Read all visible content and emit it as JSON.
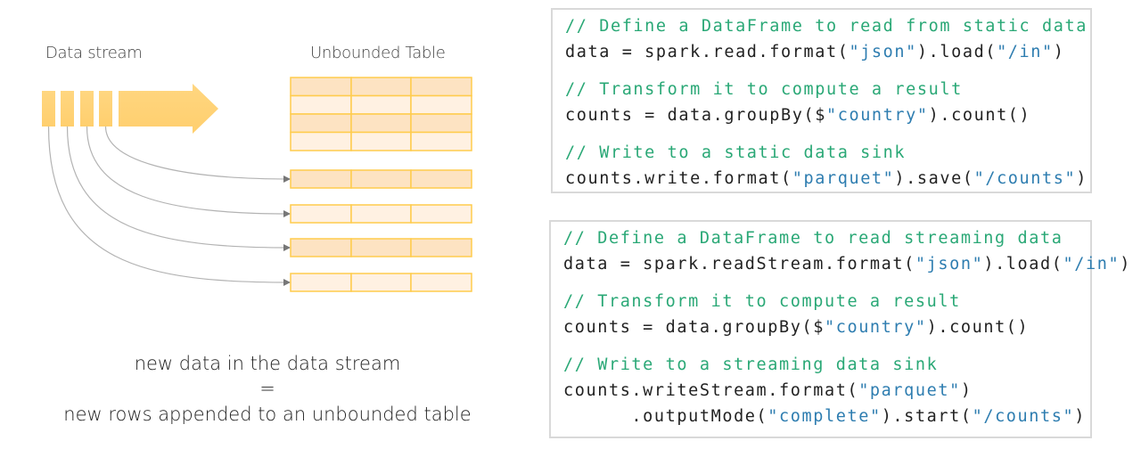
{
  "diagram": {
    "stream_label": "Data stream",
    "table_label": "Unbounded Table",
    "stream_chunks": 4,
    "table_rows": 4,
    "table_columns": 3,
    "appended_rows": 4,
    "colors": {
      "chunk_fill": "#ffd27a",
      "table_border": "#ffcc4d",
      "row_dark": "#fde3c2",
      "row_light": "#fff1e2",
      "arrow_line": "#b3b3b3",
      "arrow_head": "#777777"
    }
  },
  "caption": {
    "line1": "new data in the data stream",
    "line2": "=",
    "line3": "new rows appended to an unbounded table"
  },
  "static_code": {
    "comment1": "// Define a DataFrame to read from static data",
    "line1": [
      {
        "t": "data = spark.read.format(",
        "c": "plain"
      },
      {
        "t": "\"json\"",
        "c": "str"
      },
      {
        "t": ").load(",
        "c": "plain"
      },
      {
        "t": "\"/in\"",
        "c": "str"
      },
      {
        "t": ")",
        "c": "plain"
      }
    ],
    "comment2": "// Transform it to compute a result",
    "line2": [
      {
        "t": "counts = data.groupBy($",
        "c": "plain"
      },
      {
        "t": "\"country\"",
        "c": "str"
      },
      {
        "t": ").count()",
        "c": "plain"
      }
    ],
    "comment3": "// Write to a static data sink",
    "line3": [
      {
        "t": "counts.write.format(",
        "c": "plain"
      },
      {
        "t": "\"parquet\"",
        "c": "str"
      },
      {
        "t": ").save(",
        "c": "plain"
      },
      {
        "t": "\"/counts\"",
        "c": "str"
      },
      {
        "t": ")",
        "c": "plain"
      }
    ]
  },
  "streaming_code": {
    "comment1": "// Define a DataFrame to read streaming data",
    "line1": [
      {
        "t": "data = spark.readStream.format(",
        "c": "plain"
      },
      {
        "t": "\"json\"",
        "c": "str"
      },
      {
        "t": ").load(",
        "c": "plain"
      },
      {
        "t": "\"/in\"",
        "c": "str"
      },
      {
        "t": ")",
        "c": "plain"
      }
    ],
    "comment2": "// Transform it to compute a result",
    "line2": [
      {
        "t": "counts = data.groupBy($",
        "c": "plain"
      },
      {
        "t": "\"country\"",
        "c": "str"
      },
      {
        "t": ").count()",
        "c": "plain"
      }
    ],
    "comment3": "// Write to a streaming data sink",
    "line3": [
      {
        "t": "counts.writeStream.format(",
        "c": "plain"
      },
      {
        "t": "\"parquet\"",
        "c": "str"
      },
      {
        "t": ")",
        "c": "plain"
      }
    ],
    "line4": [
      {
        "t": "      .outputMode(",
        "c": "plain"
      },
      {
        "t": "\"complete\"",
        "c": "str"
      },
      {
        "t": ").start(",
        "c": "plain"
      },
      {
        "t": "\"/counts\"",
        "c": "str"
      },
      {
        "t": ")",
        "c": "plain"
      }
    ]
  }
}
